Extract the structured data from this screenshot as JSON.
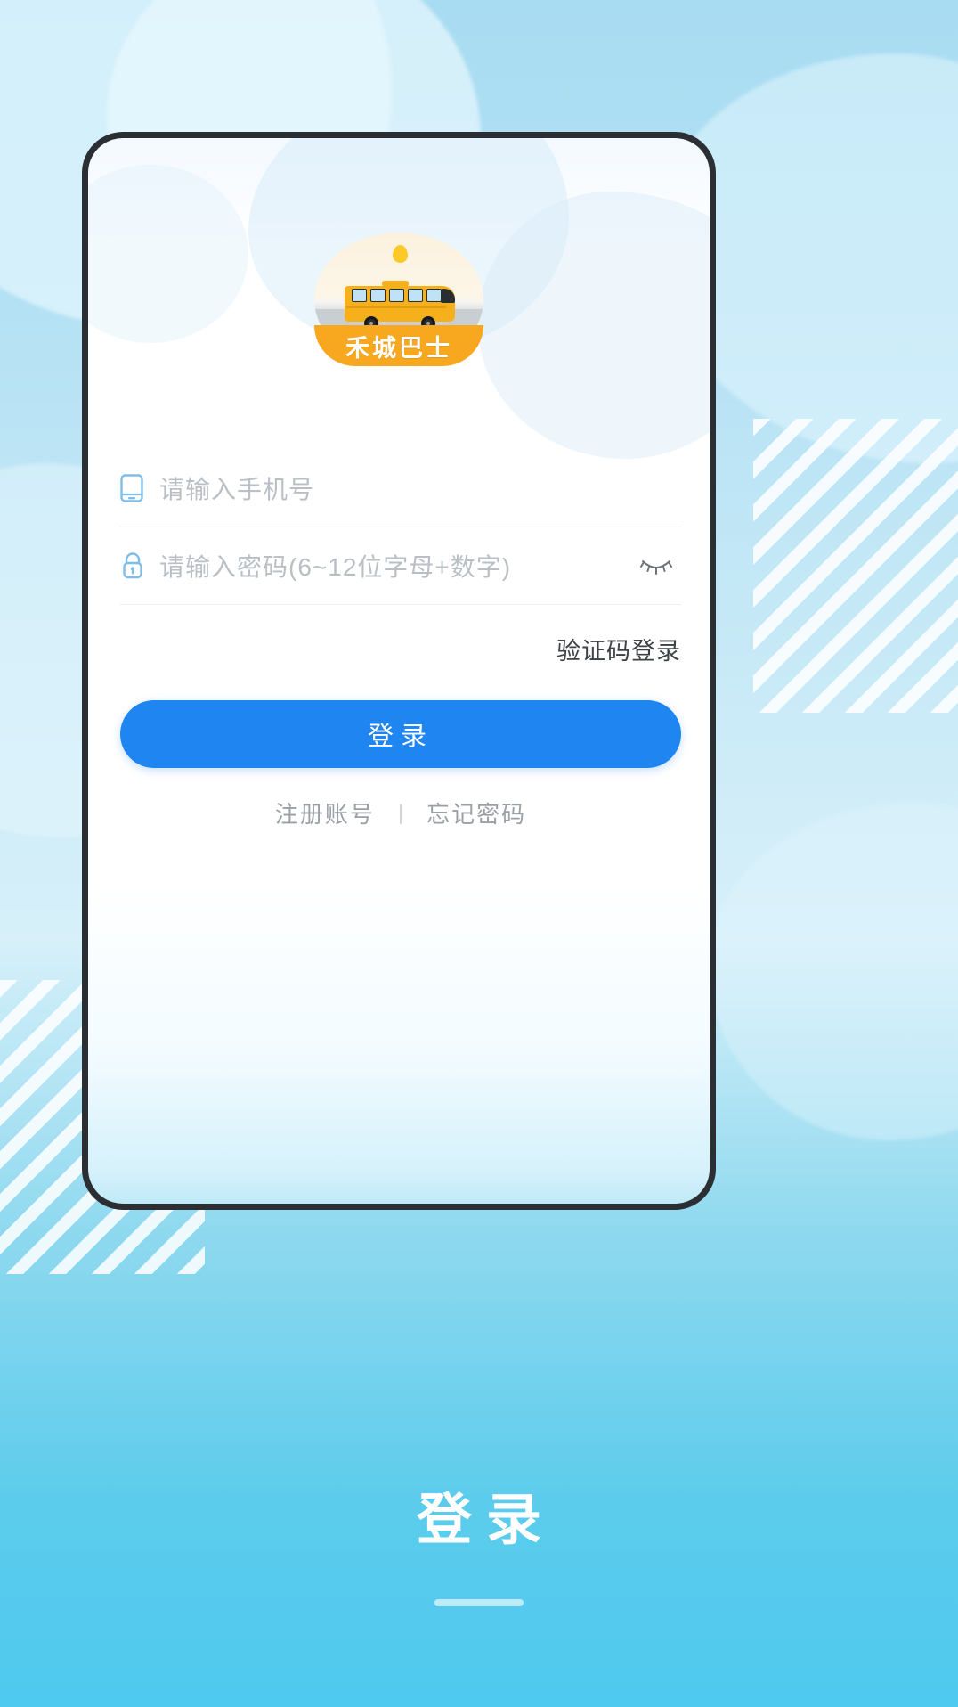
{
  "app": {
    "logo_text": "禾城巴士",
    "logo_icon": "bus-icon"
  },
  "form": {
    "phone": {
      "icon": "phone-icon",
      "placeholder": "请输入手机号",
      "value": ""
    },
    "password": {
      "icon": "lock-icon",
      "placeholder": "请输入密码(6~12位字母+数字)",
      "value": "",
      "toggle_icon": "eye-closed-icon"
    },
    "sms_login_label": "验证码登录",
    "login_button_label": "登录",
    "register_label": "注册账号",
    "divider": "|",
    "forgot_label": "忘记密码"
  },
  "page": {
    "title": "登录"
  },
  "colors": {
    "accent": "#1f85f0",
    "brand_orange": "#f7a81e",
    "background_top": "#a8dcf2",
    "background_bottom": "#4ec9ef",
    "placeholder": "#b9bfc4",
    "icon_blue": "#7fbde8"
  }
}
